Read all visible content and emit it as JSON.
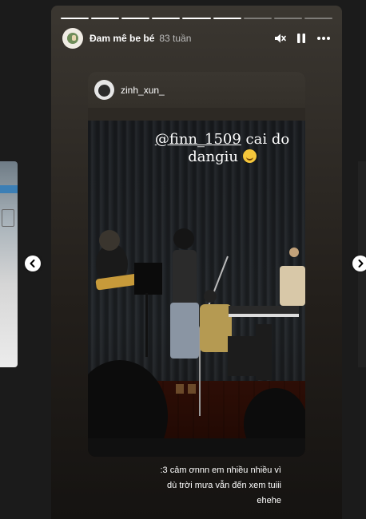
{
  "story": {
    "progress": {
      "total": 9,
      "current": 6
    },
    "header": {
      "username": "Đam mê be bé",
      "time_ago": "83 tuần",
      "icons": [
        "mute-icon",
        "pause-icon",
        "more-icon"
      ]
    },
    "embed": {
      "username": "zinh_xun_",
      "overlay_mention": "@finn_1509",
      "overlay_text": " cai do dangiu ",
      "overlay_emoji": "pleading-face-emoji"
    },
    "caption_lines": [
      ":3 cảm ơnnn em nhiều nhiều vì",
      "dù trời mưa vẫn đến xem tuiii",
      "ehehe"
    ]
  },
  "nav": {
    "prev_icon": "chevron-left-icon",
    "next_icon": "chevron-right-icon"
  }
}
